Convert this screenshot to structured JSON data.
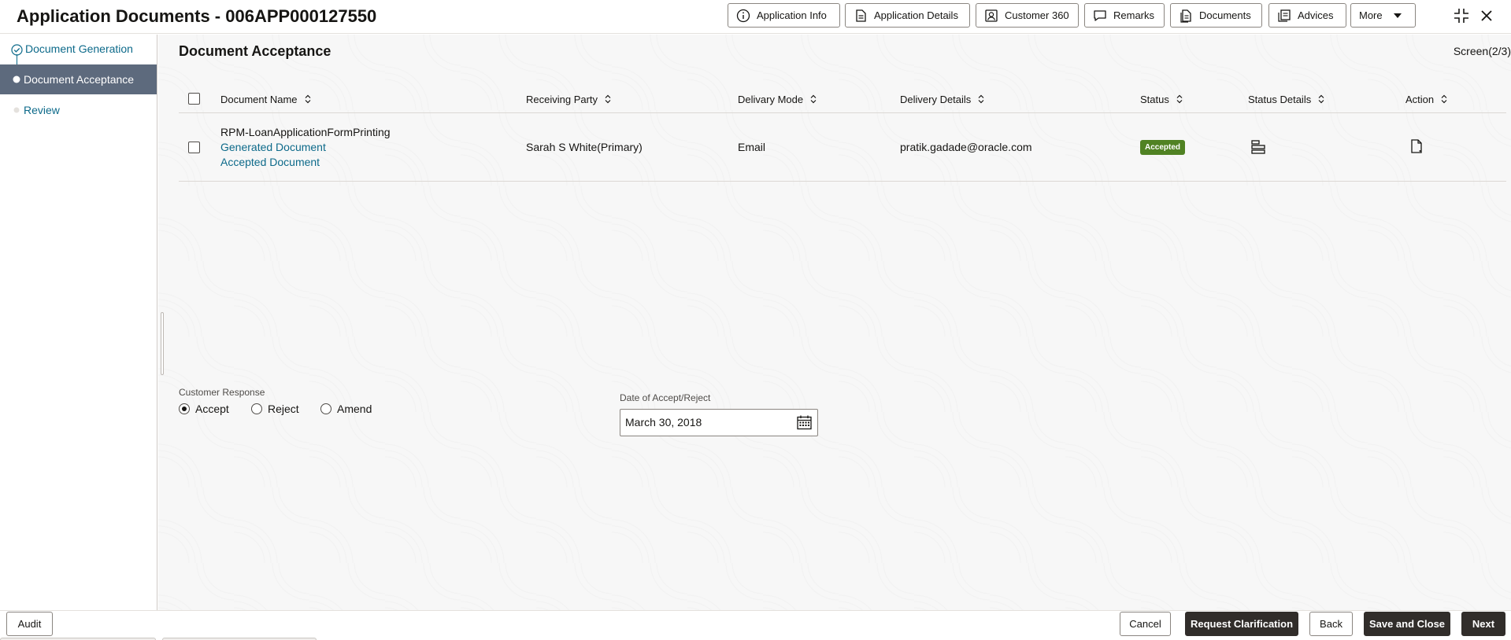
{
  "header": {
    "title": "Application Documents - 006APP000127550",
    "buttons": [
      {
        "label": "Application Info",
        "icon": "info-circle-icon"
      },
      {
        "label": "Application Details",
        "icon": "document-details-icon"
      },
      {
        "label": "Customer 360",
        "icon": "customer-card-icon"
      },
      {
        "label": "Remarks",
        "icon": "speech-bubble-icon"
      },
      {
        "label": "Documents",
        "icon": "documents-icon"
      },
      {
        "label": "Advices",
        "icon": "advices-icon"
      },
      {
        "label": "More",
        "icon": "caret-down-icon"
      }
    ],
    "window_icons": [
      "collapse-icon",
      "close-icon"
    ]
  },
  "sidebar": {
    "steps": [
      {
        "label": "Document Generation",
        "state": "completed"
      },
      {
        "label": "Document Acceptance",
        "state": "active"
      },
      {
        "label": "Review",
        "state": "pending"
      }
    ]
  },
  "main": {
    "section_title": "Document Acceptance",
    "screen_indicator": "Screen(2/3)",
    "table": {
      "columns": [
        "Document Name",
        "Receiving Party",
        "Delivary Mode",
        "Delivery Details",
        "Status",
        "Status Details",
        "Action"
      ],
      "rows": [
        {
          "document_name": "RPM-LoanApplicationFormPrinting",
          "generated_link": "Generated Document",
          "accepted_link": "Accepted Document",
          "receiving_party": "Sarah S White(Primary)",
          "delivery_mode": "Email",
          "delivery_details": "pratik.gadade@oracle.com",
          "status": "Accepted",
          "status_color": "#508223"
        }
      ]
    },
    "customer_response": {
      "label": "Customer Response",
      "options": [
        "Accept",
        "Reject",
        "Amend"
      ],
      "selected": "Accept"
    },
    "date_field": {
      "label": "Date of Accept/Reject",
      "value": "March 30, 2018"
    }
  },
  "footer": {
    "audit": "Audit",
    "cancel": "Cancel",
    "request_clarification": "Request Clarification",
    "back": "Back",
    "save_and_close": "Save and Close",
    "next": "Next"
  },
  "colors": {
    "accent_link": "#0d6a8a",
    "active_step_bg": "#5d6a7d",
    "primary_button": "#312d2a"
  }
}
